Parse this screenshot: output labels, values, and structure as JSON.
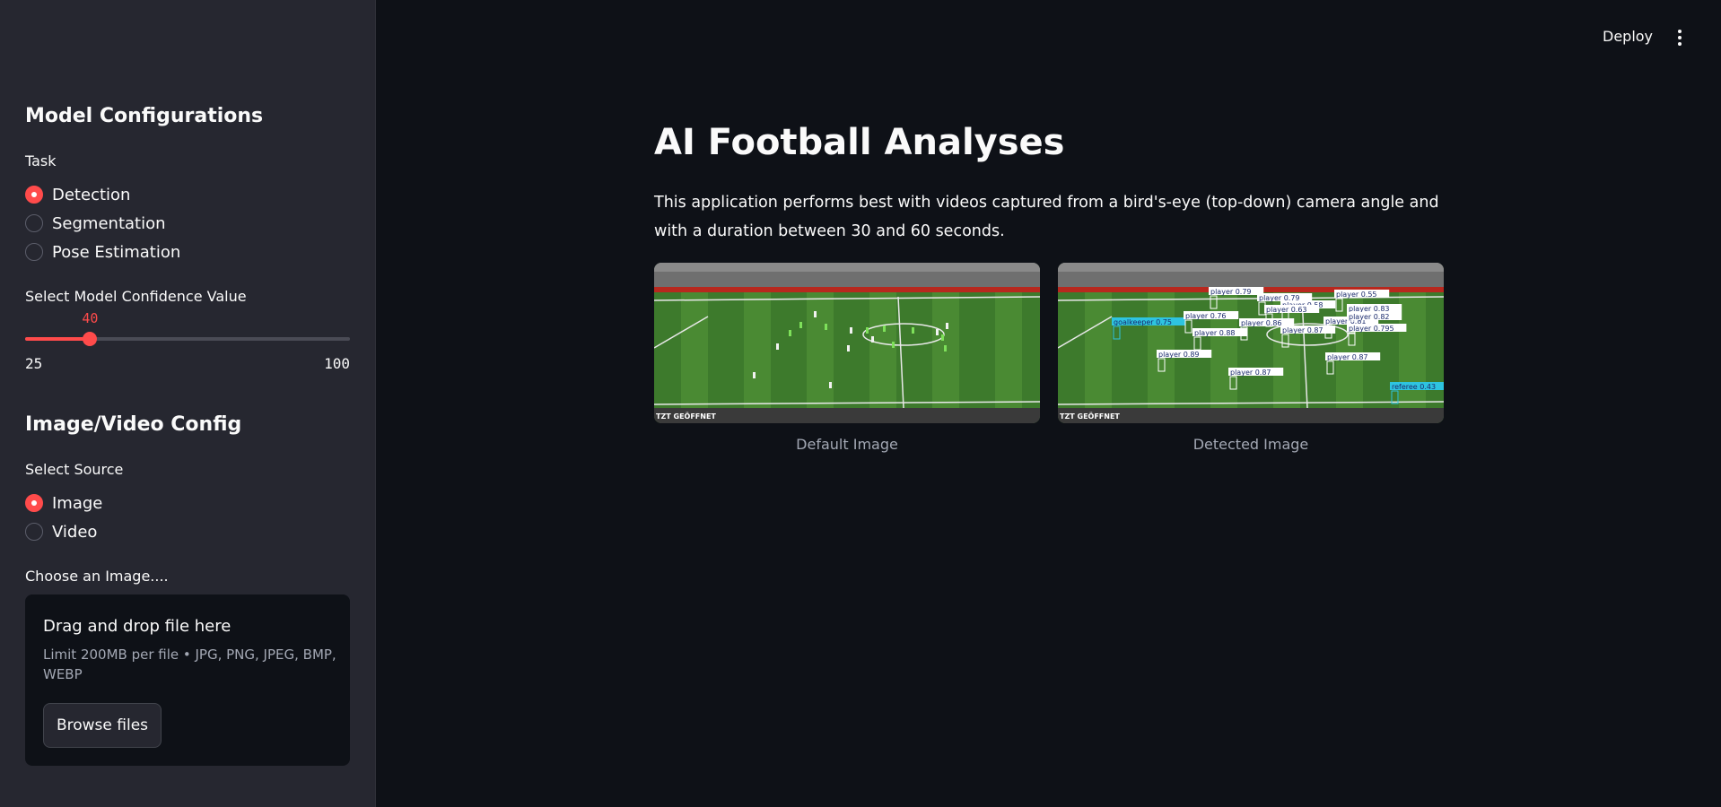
{
  "header": {
    "deploy_label": "Deploy",
    "menu_icon": "kebab-menu-icon"
  },
  "sidebar": {
    "model_section_title": "Model Configurations",
    "task_label": "Task",
    "task_options": [
      "Detection",
      "Segmentation",
      "Pose Estimation"
    ],
    "task_selected": "Detection",
    "confidence_label": "Select Model Confidence Value",
    "confidence": {
      "value": 40,
      "min": 25,
      "max": 100,
      "value_text": "40",
      "min_text": "25",
      "max_text": "100"
    },
    "source_section_title": "Image/Video Config",
    "source_label": "Select Source",
    "source_options": [
      "Image",
      "Video"
    ],
    "source_selected": "Image",
    "upload_label": "Choose an Image....",
    "dropzone_title": "Drag and drop file here",
    "dropzone_limit": "Limit 200MB per file • JPG, PNG, JPEG, BMP, WEBP",
    "browse_label": "Browse files"
  },
  "main": {
    "title": "AI Football Analyses",
    "description": "This application performs best with videos captured from a bird's-eye (top-down) camera angle and with a duration between 30 and 60 seconds.",
    "images": [
      {
        "caption": "Default Image"
      },
      {
        "caption": "Detected Image"
      }
    ],
    "banner_text": "TZT GEÖFFNET",
    "detections": [
      "goalkeeper 0.75",
      "player 0.79",
      "player 0.79",
      "player 0.58",
      "player 0.55",
      "player 0.63",
      "player 0.83",
      "player 0.76",
      "player 0.86",
      "player 0.81",
      "player 0.82",
      "player 0.88",
      "player 0.87",
      "player 0.795",
      "player 0.89",
      "player 0.87",
      "player 0.87",
      "referee 0.43"
    ]
  },
  "colors": {
    "accent": "#ff4b4b",
    "background": "#0e1117",
    "sidebar": "#262730",
    "muted_text": "#a3a8b4"
  }
}
